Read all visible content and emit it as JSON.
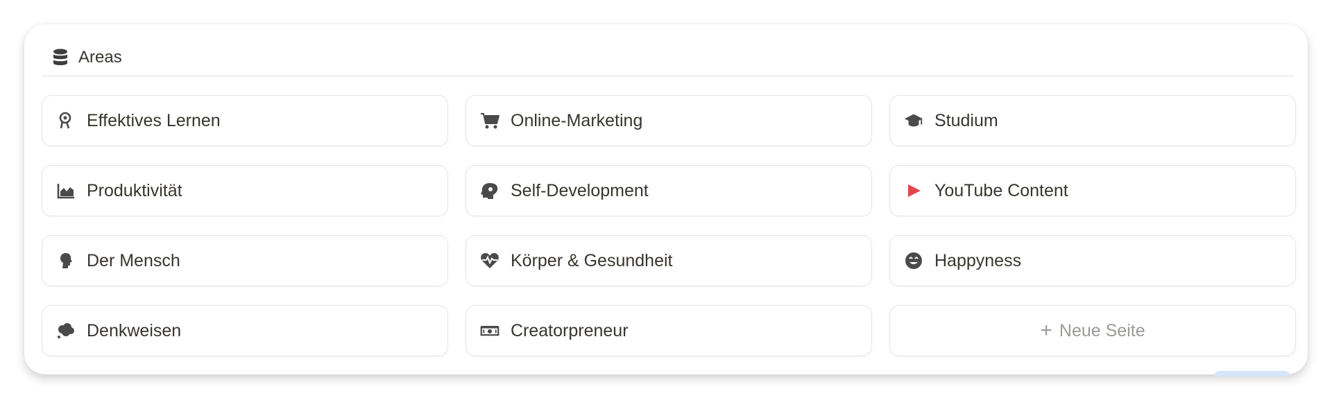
{
  "header": {
    "icon": "database-icon",
    "title": "Areas"
  },
  "cards": [
    {
      "label": "Effektives Lernen",
      "icon": "brain-head-icon"
    },
    {
      "label": "Online-Marketing",
      "icon": "shopping-cart-icon"
    },
    {
      "label": "Studium",
      "icon": "graduation-cap-icon"
    },
    {
      "label": "Produktivität",
      "icon": "area-chart-icon"
    },
    {
      "label": "Self-Development",
      "icon": "head-gear-icon"
    },
    {
      "label": "YouTube Content",
      "icon": "play-triangle-icon"
    },
    {
      "label": "Der Mensch",
      "icon": "person-head-icon"
    },
    {
      "label": "Körper & Gesundheit",
      "icon": "heartbeat-icon"
    },
    {
      "label": "Happyness",
      "icon": "smiley-icon"
    },
    {
      "label": "Denkweisen",
      "icon": "thought-cloud-icon"
    },
    {
      "label": "Creatorpreneur",
      "icon": "money-bill-icon"
    }
  ],
  "new_page": {
    "icon": "plus-icon",
    "label": "Neue Seite"
  },
  "colors": {
    "text": "#37352f",
    "muted": "#9b9a97",
    "icon": "#4a4a4a",
    "youtube_red": "#e0484a"
  }
}
